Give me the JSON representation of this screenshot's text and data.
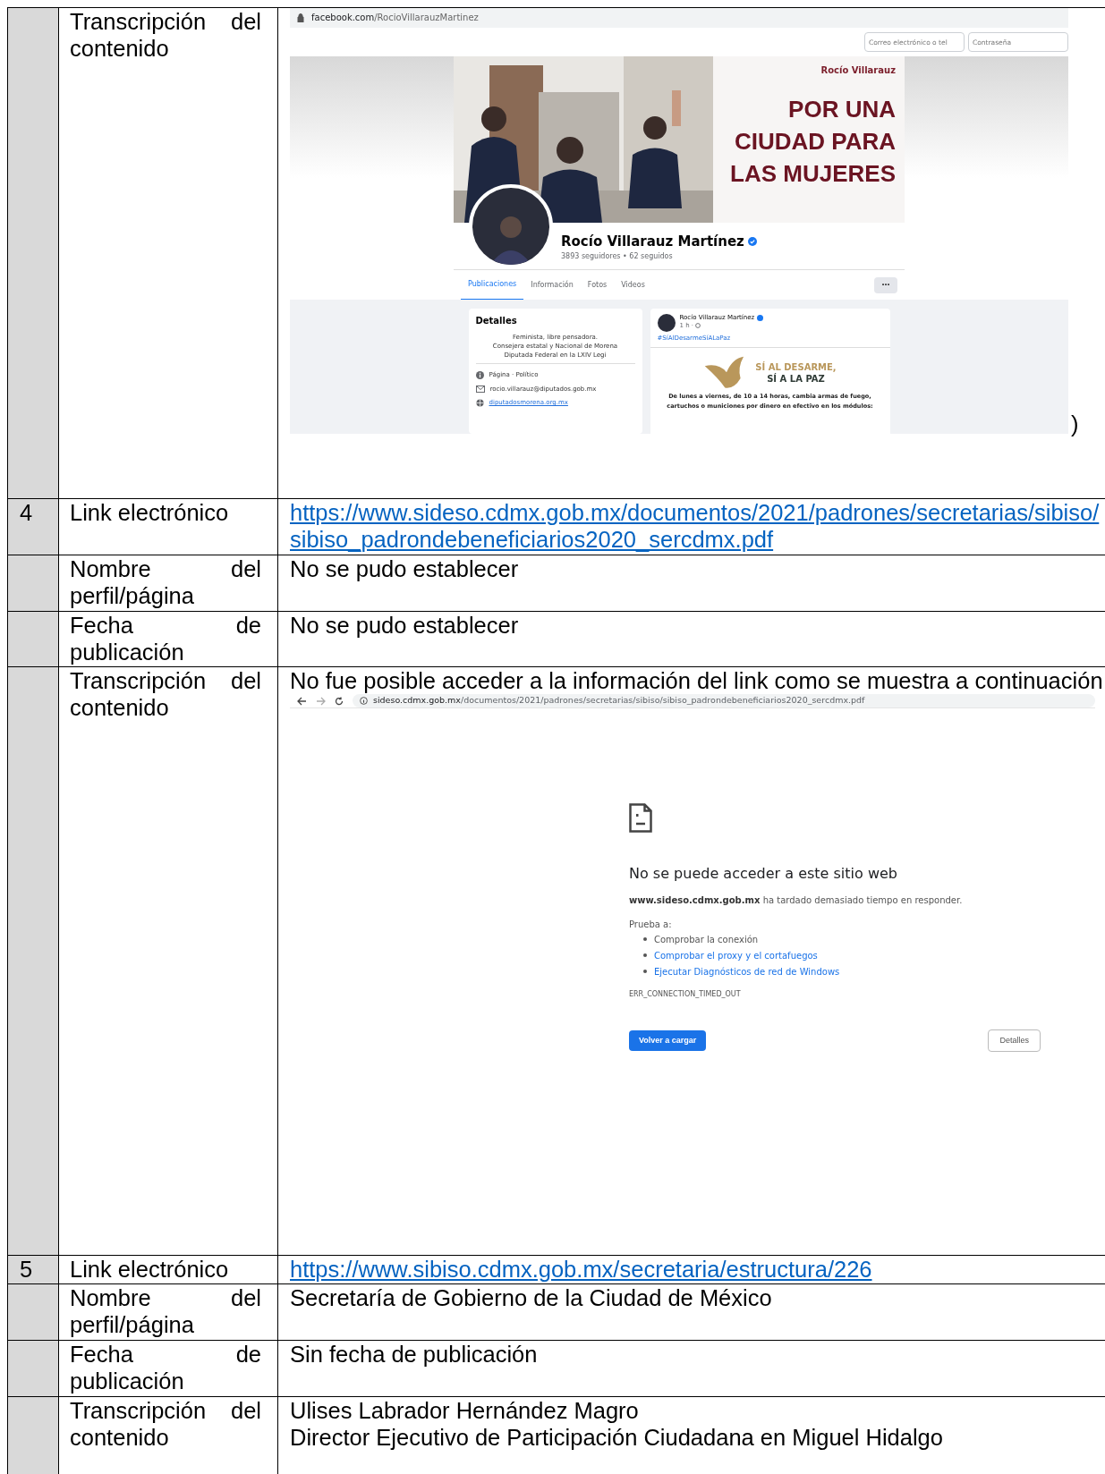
{
  "rows": [
    {
      "number": "",
      "label": "Transcripción del contenido",
      "content": {
        "kind": "facebook",
        "address_host": "facebook.com",
        "address_path": "/RocioVillarauzMartinez",
        "login_placeholders": [
          "Correo electrónico o tel",
          "Contraseña"
        ],
        "cover_logo": "Rocío Villarauz",
        "cover_headline": [
          "POR UNA",
          "CIUDAD PARA",
          "LAS MUJERES"
        ],
        "profile_name": "Rocío Villarauz Martínez",
        "verified": true,
        "profile_stats": "3893 seguidores • 62 seguidos",
        "tabs": [
          {
            "label": "Publicaciones",
            "selected": true
          },
          {
            "label": "Información",
            "selected": false
          },
          {
            "label": "Fotos",
            "selected": false
          },
          {
            "label": "Videos",
            "selected": false
          }
        ],
        "more_label": "···",
        "details_title": "Detalles",
        "bio": [
          "Feminista, libre pensadora.",
          "Consejera estatal y Nacional de Morena",
          "Diputada Federal en la LXIV Legi"
        ],
        "details_items": [
          {
            "kind": "info",
            "text": "Página · Político"
          },
          {
            "kind": "mail",
            "text": "rocio.villarauz@diputados.gob.mx"
          },
          {
            "kind": "web",
            "text": "diputadosmorena.org.mx"
          }
        ],
        "post_author": "Rocío Villarauz Martínez",
        "post_time": "1 h ·",
        "post_hashtag": "#SíAlDesarmeSíALaPaz",
        "post_image_lines": [
          "SÍ AL DESARME,",
          "SÍ A LA PAZ"
        ],
        "post_text": [
          "De lunes a viernes, de 10 a 14 horas, cambia armas de fuego,",
          "cartuchos o municiones por dinero en efectivo en los módulos:"
        ],
        "trailing": ")"
      }
    },
    {
      "number": "4",
      "label": "Link electrónico",
      "content": {
        "kind": "link",
        "text": "https://www.sideso.cdmx.gob.mx/documentos/2021/padrones/secretarias/sibiso/sibiso_padrondebeneficiarios2020_sercdmx.pdf"
      }
    },
    {
      "number": "",
      "label": "Nombre del perfil/página",
      "content": {
        "kind": "text",
        "lines": [
          "No se pudo establecer"
        ]
      }
    },
    {
      "number": "",
      "label": "Fecha de publicación",
      "content": {
        "kind": "text",
        "lines": [
          "No se pudo establecer"
        ]
      }
    },
    {
      "number": "",
      "label": "Transcripción del contenido",
      "content": {
        "kind": "error",
        "intro": "No fue posible acceder a la información del link como se muestra a continuación",
        "address_host": "sideso.cdmx.gob.mx",
        "address_path": "/documentos/2021/padrones/secretarias/sibiso/sibiso_padrondebeneficiarios2020_sercdmx.pdf",
        "heading": "No se puede acceder a este sitio web",
        "host": "www.sideso.cdmx.gob.mx",
        "message": "ha tardado demasiado tiempo en responder.",
        "try_label": "Prueba a:",
        "suggestions": [
          {
            "text": "Comprobar la conexión",
            "link": false
          },
          {
            "text": "Comprobar el proxy y el cortafuegos",
            "link": true
          },
          {
            "text": "Ejecutar Diagnósticos de red de Windows",
            "link": true
          }
        ],
        "code": "ERR_CONNECTION_TIMED_OUT",
        "reload_label": "Volver a cargar",
        "details_label": "Detalles"
      }
    },
    {
      "number": "5",
      "label": "Link electrónico",
      "content": {
        "kind": "link",
        "text": "https://www.sibiso.cdmx.gob.mx/secretaria/estructura/226"
      }
    },
    {
      "number": "",
      "label": "Nombre del perfil/página",
      "content": {
        "kind": "text",
        "lines": [
          "Secretaría de Gobierno de la Ciudad de México"
        ]
      }
    },
    {
      "number": "",
      "label": "Fecha de publicación",
      "content": {
        "kind": "text",
        "lines": [
          "Sin fecha de publicación"
        ]
      }
    },
    {
      "number": "",
      "label": "Transcripción del contenido",
      "content": {
        "kind": "text",
        "lines": [
          "Ulises Labrador Hernández Magro",
          "Director Ejecutivo de Participación Ciudadana en Miguel Hidalgo"
        ]
      }
    }
  ]
}
